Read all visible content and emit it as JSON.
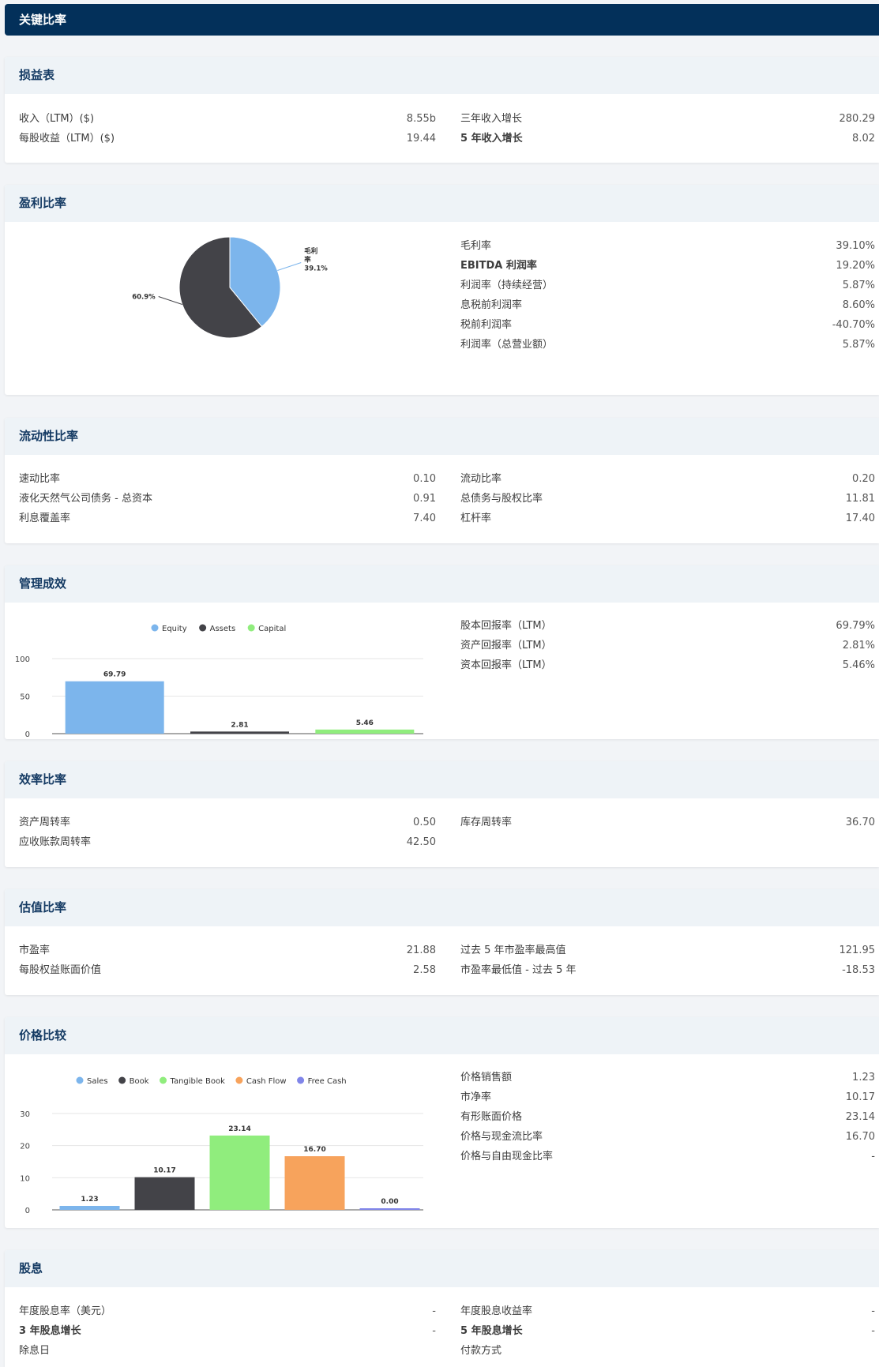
{
  "title": "关键比率",
  "income": {
    "header": "损益表",
    "left": [
      {
        "label": "收入（LTM）($)",
        "value": "8.55b"
      },
      {
        "label": "每股收益（LTM）($)",
        "value": "19.44"
      }
    ],
    "right": [
      {
        "label": "三年收入增长",
        "value": "280.29"
      },
      {
        "label": "5 年收入增长",
        "value": "8.02"
      }
    ]
  },
  "profit": {
    "header": "盈利比率",
    "rows": [
      {
        "label": "毛利率",
        "value": "39.10%"
      },
      {
        "label": "EBITDA 利润率",
        "value": "19.20%"
      },
      {
        "label": "利润率（持续经营）",
        "value": "5.87%"
      },
      {
        "label": "息税前利润率",
        "value": "8.60%"
      },
      {
        "label": "税前利润率",
        "value": "-40.70%"
      },
      {
        "label": "利润率（总营业额）",
        "value": "5.87%"
      }
    ],
    "chart_data": {
      "type": "pie",
      "slices": [
        {
          "label": "毛利率",
          "value": 39.1,
          "display": "39.1%",
          "color": "#7cb5ec"
        },
        {
          "label": "",
          "value": 60.9,
          "display": "60.9%",
          "color": "#434348"
        }
      ]
    }
  },
  "liquidity": {
    "header": "流动性比率",
    "left": [
      {
        "label": "速动比率",
        "value": "0.10"
      },
      {
        "label": "液化天然气公司债务 - 总资本",
        "value": "0.91"
      },
      {
        "label": "利息覆盖率",
        "value": "7.40"
      }
    ],
    "right": [
      {
        "label": "流动比率",
        "value": "0.20"
      },
      {
        "label": "总债务与股权比率",
        "value": "11.81"
      },
      {
        "label": "杠杆率",
        "value": "17.40"
      }
    ]
  },
  "management": {
    "header": "管理成效",
    "rows": [
      {
        "label": "股本回报率（LTM）",
        "value": "69.79%"
      },
      {
        "label": "资产回报率（LTM）",
        "value": "2.81%"
      },
      {
        "label": "资本回报率（LTM）",
        "value": "5.46%"
      }
    ],
    "chart_data": {
      "type": "bar",
      "categories": [
        "Equity",
        "Assets",
        "Capital"
      ],
      "series": [
        {
          "name": "Equity",
          "value": 69.79,
          "label": "69.79",
          "color": "#7cb5ec"
        },
        {
          "name": "Assets",
          "value": 2.81,
          "label": "2.81",
          "color": "#434348"
        },
        {
          "name": "Capital",
          "value": 5.46,
          "label": "5.46",
          "color": "#90ed7d"
        }
      ],
      "yticks": [
        "0",
        "50",
        "100"
      ],
      "ylim": [
        0,
        100
      ],
      "legend": "top"
    }
  },
  "efficiency": {
    "header": "效率比率",
    "left": [
      {
        "label": "资产周转率",
        "value": "0.50"
      },
      {
        "label": "应收账款周转率",
        "value": "42.50"
      }
    ],
    "right": [
      {
        "label": "库存周转率",
        "value": "36.70"
      }
    ]
  },
  "valuation": {
    "header": "估值比率",
    "left": [
      {
        "label": "市盈率",
        "value": "21.88"
      },
      {
        "label": "每股权益账面价值",
        "value": "2.58"
      }
    ],
    "right": [
      {
        "label": "过去 5 年市盈率最高值",
        "value": "121.95"
      },
      {
        "label": "市盈率最低值 - 过去 5 年",
        "value": "-18.53"
      }
    ]
  },
  "price": {
    "header": "价格比较",
    "rows": [
      {
        "label": "价格销售额",
        "value": "1.23"
      },
      {
        "label": "市净率",
        "value": "10.17"
      },
      {
        "label": "有形账面价格",
        "value": "23.14"
      },
      {
        "label": "价格与现金流比率",
        "value": "16.70"
      },
      {
        "label": "价格与自由现金比率",
        "value": "-"
      }
    ],
    "chart_data": {
      "type": "bar",
      "categories": [
        "Sales",
        "Book",
        "Tangible Book",
        "Cash Flow",
        "Free Cash"
      ],
      "series": [
        {
          "name": "Sales",
          "value": 1.23,
          "label": "1.23",
          "color": "#7cb5ec"
        },
        {
          "name": "Book",
          "value": 10.17,
          "label": "10.17",
          "color": "#434348"
        },
        {
          "name": "Tangible Book",
          "value": 23.14,
          "label": "23.14",
          "color": "#90ed7d"
        },
        {
          "name": "Cash Flow",
          "value": 16.7,
          "label": "16.70",
          "color": "#f7a35c"
        },
        {
          "name": "Free Cash",
          "value": 0.0,
          "label": "0.00",
          "color": "#8085e9"
        }
      ],
      "yticks": [
        "0",
        "10",
        "20",
        "30"
      ],
      "ylim": [
        0,
        30
      ],
      "legend": "top"
    }
  },
  "dividend": {
    "header": "股息",
    "left": [
      {
        "label": "年度股息率（美元）",
        "value": "-"
      },
      {
        "label": "3 年股息增长",
        "value": "-"
      },
      {
        "label": "除息日",
        "value": ""
      }
    ],
    "right": [
      {
        "label": "年度股息收益率",
        "value": "-"
      },
      {
        "label": "5 年股息增长",
        "value": "-"
      },
      {
        "label": "付款方式",
        "value": ""
      }
    ]
  }
}
